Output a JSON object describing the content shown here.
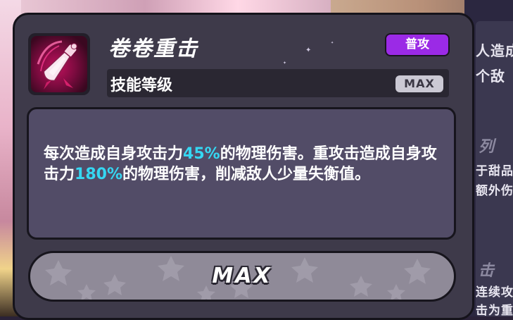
{
  "skill": {
    "name": "卷卷重击",
    "tag": "普攻",
    "level_label": "技能等级",
    "level_value": "MAX",
    "description": {
      "part1": "每次造成自身攻击力",
      "value1": "45%",
      "part2": "的物理伤害。重攻击造成自身攻击力",
      "value2": "180%",
      "part3": "的物理伤害，削减敌人少量失衡值。"
    },
    "icon": "baseball-bat-icon",
    "button_label": "MAX"
  },
  "side_panel": {
    "lines": [
      "人造成",
      "个敌",
      "列",
      "于甜品",
      "额外伤",
      "击",
      "连续攻",
      "击为重"
    ]
  },
  "colors": {
    "highlight": "#35d7f2",
    "tag_bg": "#9b2ae6",
    "card_bg": "#3e3a4a",
    "desc_bg": "#524c67"
  }
}
